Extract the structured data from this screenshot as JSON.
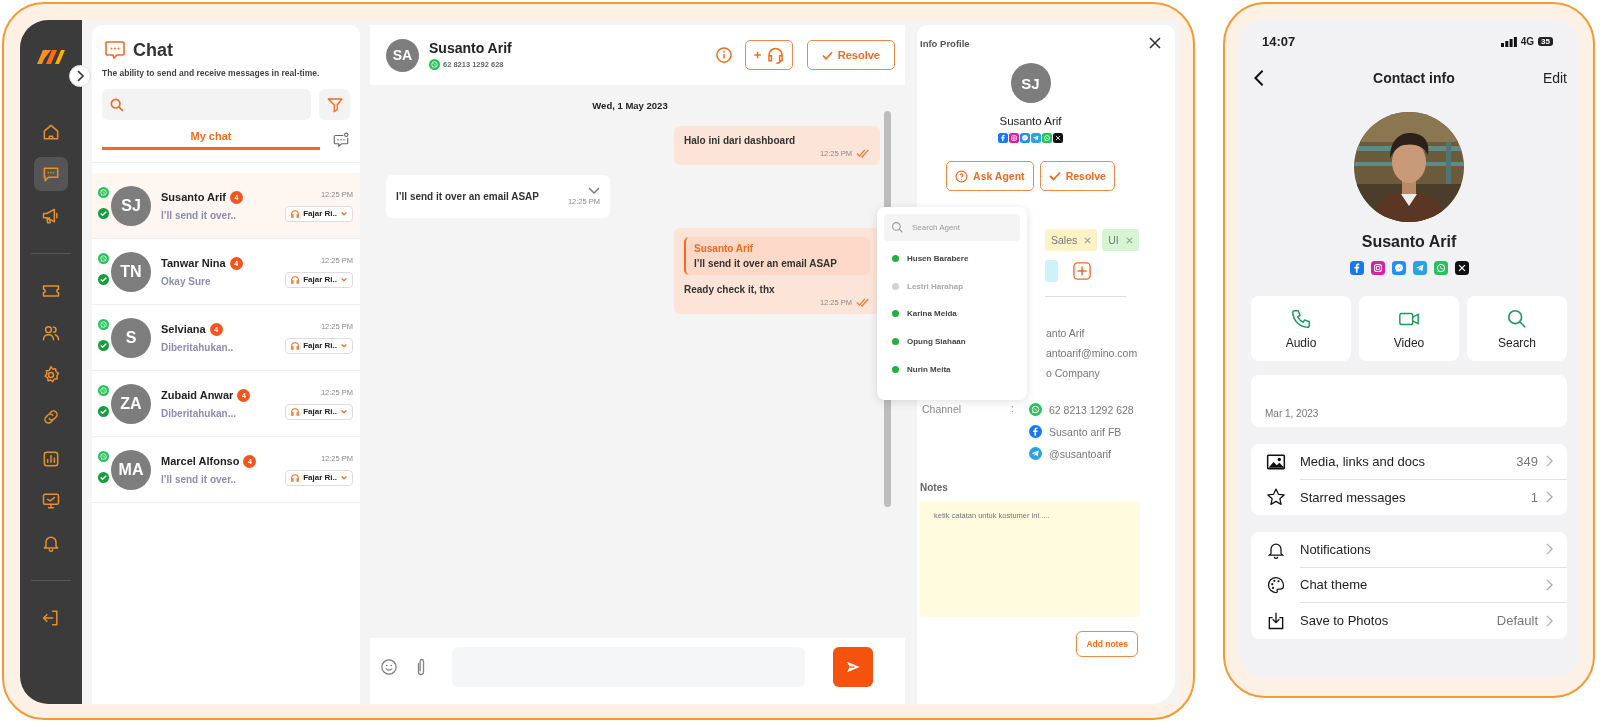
{
  "sidebar": {
    "items": [
      {
        "kind": "home",
        "selected": false
      },
      {
        "kind": "chat",
        "selected": true
      },
      {
        "kind": "campaign",
        "selected": false
      },
      {
        "kind": "divider"
      },
      {
        "kind": "ticket",
        "selected": false
      },
      {
        "kind": "users",
        "selected": false
      },
      {
        "kind": "settings",
        "selected": false
      },
      {
        "kind": "link",
        "selected": false
      },
      {
        "kind": "report",
        "selected": false
      },
      {
        "kind": "monitor",
        "selected": false
      },
      {
        "kind": "bell",
        "selected": false
      },
      {
        "kind": "divider"
      },
      {
        "kind": "logout",
        "selected": false
      }
    ]
  },
  "chat_list": {
    "title": "Chat",
    "subtitle": "The ability to send and receive messages in real-time.",
    "tabs": [
      {
        "label": "My chat",
        "selected": true
      }
    ],
    "conversations": [
      {
        "initials": "SJ",
        "name": "Susanto Arif",
        "badge": "4",
        "preview": "I’ll send it over..",
        "time": "12:25 PM",
        "agent": "Fajar Ri..",
        "selected": true
      },
      {
        "initials": "TN",
        "name": "Tanwar Nina",
        "badge": "4",
        "preview": "Okay Sure",
        "time": "12:25 PM",
        "agent": "Fajar Ri..",
        "selected": false
      },
      {
        "initials": "S",
        "name": "Selviana",
        "badge": "4",
        "preview": "Diberitahukan..",
        "time": "12:25 PM",
        "agent": "Fajar Ri..",
        "selected": false
      },
      {
        "initials": "ZA",
        "name": "Zubaid Anwar",
        "badge": "4",
        "preview": "Diberitahukan...",
        "time": "12:25 PM",
        "agent": "Fajar Ri..",
        "selected": false
      },
      {
        "initials": "MA",
        "name": "Marcel Alfonso",
        "badge": "4",
        "preview": "I’ll send it over..",
        "time": "12:25 PM",
        "agent": "Fajar Ri..",
        "selected": false
      }
    ]
  },
  "conversation": {
    "initials": "SA",
    "name": "Susanto Arif",
    "phone": "62 8213 1292 628",
    "resolve": "Resolve",
    "date": "Wed, 1 May 2023",
    "messages": [
      {
        "kind": "outgoing",
        "text": "Halo ini dari dashboard",
        "time": "12:25 PM",
        "read": true
      },
      {
        "kind": "incoming",
        "text": "I’ll send it over an email ASAP",
        "time": "12:25 PM"
      },
      {
        "kind": "outgoing",
        "reply": {
          "name": "Susanto Arif",
          "text": "I’ll send it over an email ASAP"
        },
        "text": "Ready check it, thx",
        "time": "12:25 PM",
        "read": true
      }
    ]
  },
  "info_profile": {
    "title": "Info Profile",
    "initials": "SJ",
    "name": "Susanto Arif",
    "channels": [
      {
        "kind": "facebook"
      },
      {
        "kind": "instagram"
      },
      {
        "kind": "messenger"
      },
      {
        "kind": "telegram"
      },
      {
        "kind": "whatsapp"
      },
      {
        "kind": "x"
      }
    ],
    "ask_agent": "Ask Agent",
    "resolve": "Resolve",
    "tags": [
      {
        "label": "Sales",
        "color": "#fbf3c6"
      },
      {
        "label": "UI",
        "color": "#d6f5d2"
      },
      {
        "color": "#cdf2fa"
      }
    ],
    "fields": [
      "anto Arif",
      "antoarif@mino.com",
      "o Company"
    ],
    "channel_label": "Channel",
    "channel_separator": ":",
    "contact_channels": [
      {
        "kind": "whatsapp",
        "text": "62 8213 1292 628"
      },
      {
        "kind": "facebook",
        "text": "Susanto arif FB"
      },
      {
        "kind": "telegram",
        "text": "@susantoarif"
      }
    ],
    "notes_title": "Notes",
    "notes_placeholder": "ketik catatan untuk kostumer ini.....",
    "add_notes": "Add notes"
  },
  "agent_dropdown": {
    "placeholder": "Search Agent",
    "agents": [
      {
        "name": "Husen Barabere",
        "online": true
      },
      {
        "name": "Lestri Harahap",
        "online": false
      },
      {
        "name": "Karina Melda",
        "online": true
      },
      {
        "name": "Opung Siahaan",
        "online": true
      },
      {
        "name": "Nurin Meita",
        "online": true
      }
    ]
  },
  "phone": {
    "time": "14:07",
    "network": "4G",
    "battery": "35",
    "title": "Contact info",
    "edit": "Edit",
    "photo": {
      "kind": "picture"
    },
    "name": "Susanto Arif",
    "channels": [
      {
        "kind": "facebook"
      },
      {
        "kind": "instagram"
      },
      {
        "kind": "messenger"
      },
      {
        "kind": "telegram"
      },
      {
        "kind": "whatsapp"
      },
      {
        "kind": "x"
      }
    ],
    "actions": [
      {
        "kind": "audio",
        "label": "Audio"
      },
      {
        "kind": "video",
        "label": "Video"
      },
      {
        "kind": "search",
        "label": "Search"
      }
    ],
    "about_date": "Mar 1, 2023",
    "groups": [
      [
        {
          "kind": "media",
          "label": "Media, links and docs",
          "value": "349"
        },
        {
          "kind": "star",
          "label": "Starred messages",
          "value": "1"
        }
      ],
      [
        {
          "kind": "bell",
          "label": "Notifications"
        },
        {
          "kind": "palette",
          "label": "Chat theme"
        },
        {
          "kind": "download",
          "label": "Save to Photos",
          "value": "Default"
        }
      ]
    ]
  }
}
